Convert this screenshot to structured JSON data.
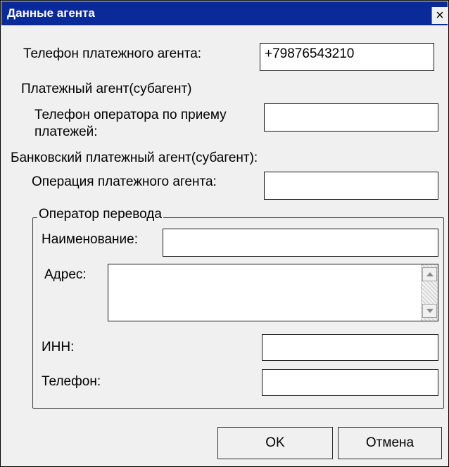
{
  "window": {
    "title": "Данные агента",
    "close_glyph": "×"
  },
  "agent_phone": {
    "label": "Телефон платежного агента:",
    "value": "+79876543210"
  },
  "payment_agent": {
    "section_label": "Платежный агент(субагент)",
    "operator_phone_label_1": "Телефон оператора по приему",
    "operator_phone_label_2": "платежей:",
    "operator_phone_value": ""
  },
  "bank_agent": {
    "section_label": "Банковский платежный агент(субагент):",
    "operation_label": "Операция платежного агента:",
    "operation_value": ""
  },
  "transfer_operator": {
    "group_title": "Оператор перевода",
    "name_label": "Наименование:",
    "name_value": "",
    "address_label": "Адрес:",
    "address_value": "",
    "inn_label": "ИНН:",
    "inn_value": "",
    "phone_label": "Телефон:",
    "phone_value": ""
  },
  "buttons": {
    "ok": "OK",
    "cancel": "Отмена"
  },
  "icons": {
    "scroll_up": "triangle-up-icon",
    "scroll_down": "triangle-down-icon",
    "close": "close-icon"
  }
}
